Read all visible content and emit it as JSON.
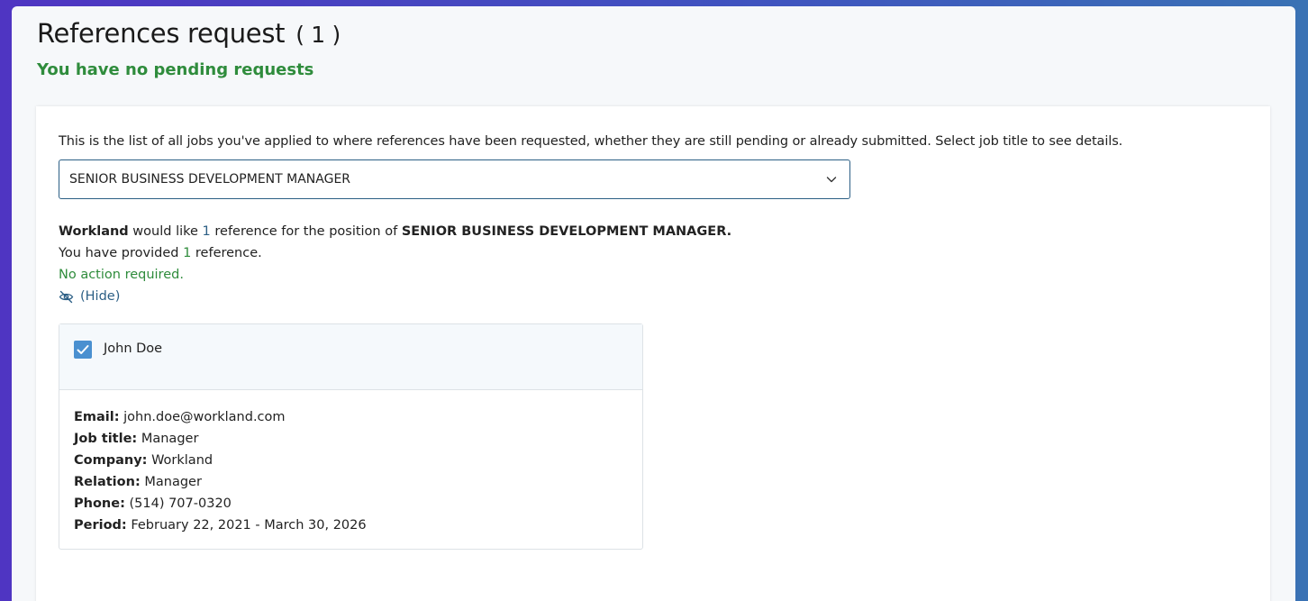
{
  "header": {
    "title": "References request",
    "count": "( 1 )",
    "status": "You have no pending requests"
  },
  "card": {
    "intro": "This is the list of all jobs you've applied to where references have been requested, whether they are still pending or already submitted. Select job title to see details.",
    "job_select": {
      "selected": "SENIOR BUSINESS DEVELOPMENT MANAGER"
    },
    "summary": {
      "company": "Workland",
      "would_like": " would like ",
      "requested_count": "1",
      "reference_word": " reference  for the position of ",
      "position": "SENIOR BUSINESS DEVELOPMENT MANAGER.",
      "provided_prefix": "You have provided ",
      "provided_count": "1",
      "provided_suffix": " reference.",
      "action": "No action required.",
      "hide_label": "(Hide)"
    },
    "reference": {
      "name": "John Doe",
      "checked": true,
      "fields": [
        {
          "label": "Email:",
          "value": "john.doe@workland.com"
        },
        {
          "label": "Job title:",
          "value": "Manager"
        },
        {
          "label": "Company:",
          "value": "Workland"
        },
        {
          "label": "Relation:",
          "value": "Manager"
        },
        {
          "label": "Phone:",
          "value": "(514) 707-0320"
        },
        {
          "label": "Period:",
          "value": "February 22, 2021 - March 30, 2026"
        }
      ]
    }
  },
  "icons": {
    "select_arrow": "chevron-down-icon",
    "hide": "eye-slash-icon",
    "check": "check-icon"
  },
  "colors": {
    "accent_blue": "#2c5f85",
    "success_green": "#2f8c3c",
    "checkbox_blue": "#4a90d0"
  }
}
